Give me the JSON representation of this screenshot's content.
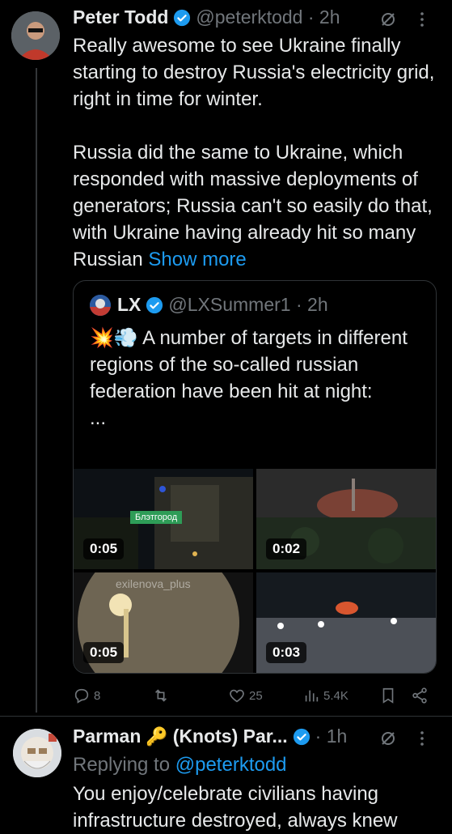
{
  "tweet1": {
    "name": "Peter Todd",
    "handle": "@peterktodd",
    "time": "2h",
    "paragraph1": "Really awesome to see Ukraine finally starting to destroy Russia's electricity grid, right in time for winter.",
    "paragraph2": "Russia did the same to Ukraine, which responded with massive deployments of generators; Russia can't so easily do that, with Ukraine having already hit so many Russian",
    "show_more": "Show more"
  },
  "quote": {
    "name": "LX",
    "handle": "@LXSummer1",
    "time": "2h",
    "emojis": "💥💨",
    "text": "A number of targets in different regions of the so-called russian federation have been hit at night:",
    "ellipsis": "...",
    "videos": [
      {
        "duration": "0:05",
        "label": "Блэтгород"
      },
      {
        "duration": "0:02"
      },
      {
        "duration": "0:05",
        "watermark": "exilenova_plus"
      },
      {
        "duration": "0:03"
      }
    ]
  },
  "actions": {
    "replies": "8",
    "reposts": "",
    "likes": "25",
    "views": "5.4K"
  },
  "tweet2": {
    "name_part": "Parman",
    "name_rest": "(Knots) Par...",
    "time": "1h",
    "replying_prefix": "Replying to",
    "replying_handle": "@peterktodd",
    "text": "You enjoy/celebrate civilians having infrastructure destroyed, always knew"
  },
  "colors": {
    "accent": "#1d9bf0",
    "muted": "#71767b",
    "background": "#000000"
  }
}
